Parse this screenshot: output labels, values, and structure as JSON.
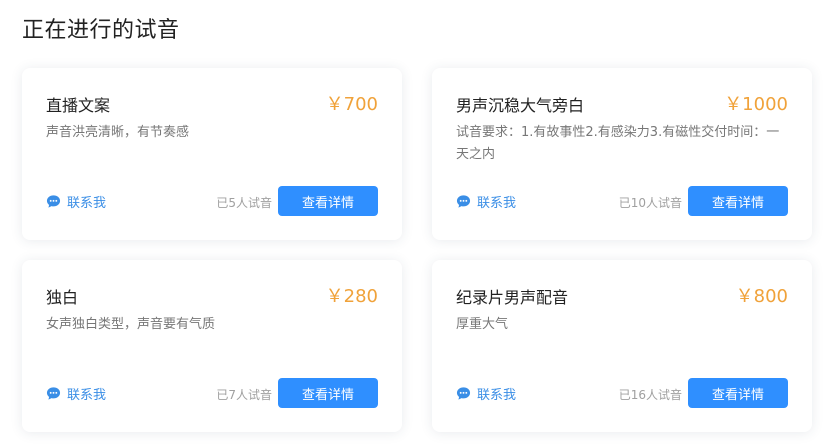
{
  "page": {
    "title": "正在进行的试音"
  },
  "cards": [
    {
      "title": "直播文案",
      "price": "￥700",
      "desc": "声音洪亮清晰，有节奏感",
      "contact": "联系我",
      "count": "已5人试音",
      "button": "查看详情"
    },
    {
      "title": "男声沉稳大气旁白",
      "price": "￥1000",
      "desc": "试音要求：1.有故事性2.有感染力3.有磁性交付时间：一天之内",
      "contact": "联系我",
      "count": "已10人试音",
      "button": "查看详情"
    },
    {
      "title": "独白",
      "price": "￥280",
      "desc": "女声独白类型，声音要有气质",
      "contact": "联系我",
      "count": "已7人试音",
      "button": "查看详情"
    },
    {
      "title": "纪录片男声配音",
      "price": "￥800",
      "desc": "厚重大气",
      "contact": "联系我",
      "count": "已16人试音",
      "button": "查看详情"
    }
  ],
  "icons": {
    "contact": "chat-bubble-icon"
  },
  "colors": {
    "accent": "#2f8fff",
    "price": "#f0a23a",
    "link": "#3a8ee6"
  }
}
